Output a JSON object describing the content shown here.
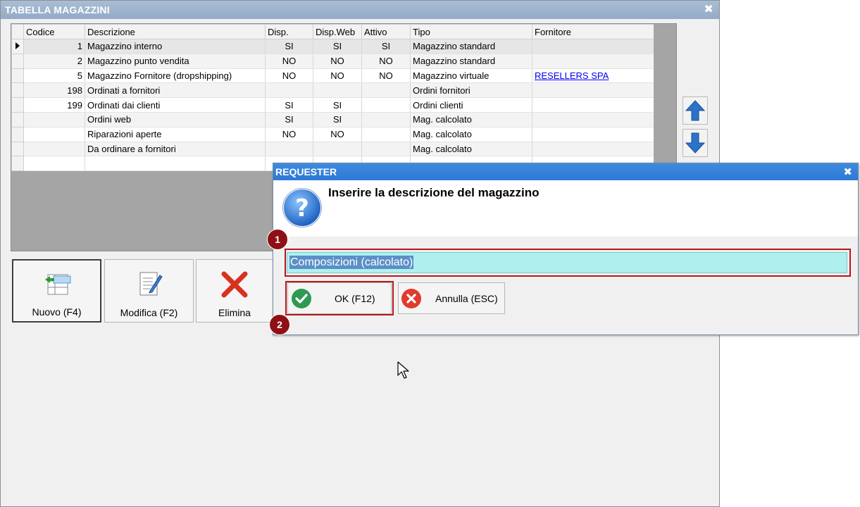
{
  "window": {
    "title": "TABELLA MAGAZZINI",
    "close": "✖"
  },
  "grid": {
    "columns": [
      "Codice",
      "Descrizione",
      "Disp.",
      "Disp.Web",
      "Attivo",
      "Tipo",
      "Fornitore"
    ],
    "rows": [
      {
        "codice": "1",
        "descrizione": "Magazzino interno",
        "disp": "SI",
        "disp_web": "SI",
        "attivo": "SI",
        "tipo": "Magazzino standard",
        "fornitore": ""
      },
      {
        "codice": "2",
        "descrizione": "Magazzino punto vendita",
        "disp": "NO",
        "disp_web": "NO",
        "attivo": "NO",
        "tipo": "Magazzino standard",
        "fornitore": ""
      },
      {
        "codice": "5",
        "descrizione": "Magazzino Fornitore (dropshipping)",
        "disp": "NO",
        "disp_web": "NO",
        "attivo": "NO",
        "tipo": "Magazzino virtuale",
        "fornitore": "RESELLERS SPA"
      },
      {
        "codice": "198",
        "descrizione": "Ordinati a fornitori",
        "disp": "",
        "disp_web": "",
        "attivo": "",
        "tipo": "Ordini fornitori",
        "fornitore": ""
      },
      {
        "codice": "199",
        "descrizione": "Ordinati dai clienti",
        "disp": "SI",
        "disp_web": "SI",
        "attivo": "",
        "tipo": "Ordini clienti",
        "fornitore": ""
      },
      {
        "codice": "",
        "descrizione": "Ordini web",
        "disp": "SI",
        "disp_web": "SI",
        "attivo": "",
        "tipo": "Mag. calcolato",
        "fornitore": ""
      },
      {
        "codice": "",
        "descrizione": "Riparazioni aperte",
        "disp": "NO",
        "disp_web": "NO",
        "attivo": "",
        "tipo": "Mag. calcolato",
        "fornitore": ""
      },
      {
        "codice": "",
        "descrizione": "Da ordinare a fornitori",
        "disp": "",
        "disp_web": "",
        "attivo": "",
        "tipo": "Mag. calcolato",
        "fornitore": ""
      }
    ]
  },
  "buttons": {
    "nuovo": "Nuovo (F4)",
    "modifica": "Modifica (F2)",
    "elimina": "Elimina"
  },
  "dialog": {
    "title": "REQUESTER",
    "close": "✖",
    "prompt": "Inserire la descrizione del magazzino",
    "input_value": "Composizioni (calcolato)",
    "ok_label": "OK (F12)",
    "cancel_label": "Annulla (ESC)"
  },
  "badges": {
    "one": "1",
    "two": "2"
  },
  "colors": {
    "dialog_title": "#2c78d4",
    "input_bg": "#aff0ef",
    "highlight": "#b8161c",
    "badge": "#8e1015",
    "arrow_blue": "#2a73c9"
  }
}
